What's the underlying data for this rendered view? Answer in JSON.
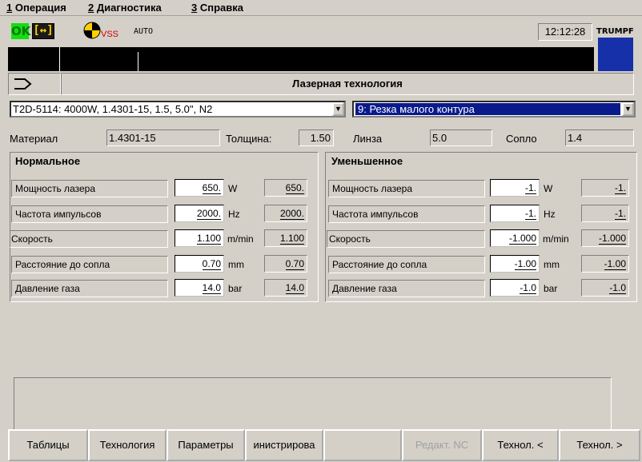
{
  "menu": [
    {
      "num": "1",
      "label": "Операция"
    },
    {
      "num": "2",
      "label": "Диагностика"
    },
    {
      "num": "3",
      "label": "Справка"
    }
  ],
  "status": {
    "ok_label": "OK",
    "plug_icon": "connector-icon",
    "vss": "VSS",
    "mode": "AUTO",
    "time": "12:12:28",
    "brand": "TRUMPF",
    "colors": {
      "ok_bg": "#10e010",
      "vss": "#d00000",
      "brand_box": "#1530a8"
    }
  },
  "header": {
    "nav_icon": "arrow-right-icon",
    "title": "Лазерная технология"
  },
  "selectors": {
    "program": "T2D-5114:  4000W,  1.4301-15,  1.5,  5.0\", N2",
    "technology": "9:  Резка малого контура",
    "selected_color": "#0a1a8c"
  },
  "info": {
    "material_label": "Материал",
    "material_value": "1.4301-15",
    "thickness_label": "Толщина:",
    "thickness_value": "1.50",
    "lens_label": "Линза",
    "lens_value": "5.0",
    "nozzle_label": "Сопло",
    "nozzle_value": "1.4"
  },
  "normal": {
    "title": "Нормальное",
    "rows": [
      {
        "label": "Мощность лазера",
        "value": "650.",
        "unit": "W",
        "readonly": "650."
      },
      {
        "label": "Частота импульсов",
        "value": "2000.",
        "unit": "Hz",
        "readonly": "2000."
      },
      {
        "label": "Скорость",
        "value": "1.100",
        "unit": "m/min",
        "readonly": "1.100"
      },
      {
        "label": "Расстояние до сопла",
        "value": "0.70",
        "unit": "mm",
        "readonly": "0.70"
      },
      {
        "label": "Давление газа",
        "value": "14.0",
        "unit": "bar",
        "readonly": "14.0"
      }
    ]
  },
  "reduced": {
    "title": "Уменьшенное",
    "rows": [
      {
        "label": "Мощность лазера",
        "value": "-1.",
        "unit": "W",
        "readonly": "-1."
      },
      {
        "label": "Частота импульсов",
        "value": "-1.",
        "unit": "Hz",
        "readonly": "-1."
      },
      {
        "label": "Скорость",
        "value": "-1.000",
        "unit": "m/min",
        "readonly": "-1.000"
      },
      {
        "label": "Расстояние до сопла",
        "value": "-1.00",
        "unit": "mm",
        "readonly": "-1.00"
      },
      {
        "label": "Давление газа",
        "value": "-1.0",
        "unit": "bar",
        "readonly": "-1.0"
      }
    ]
  },
  "softkeys": [
    {
      "label": "Таблицы",
      "enabled": true
    },
    {
      "label": "Технология",
      "enabled": true
    },
    {
      "label": "Параметры",
      "enabled": true
    },
    {
      "label": "инистрирова",
      "enabled": true
    },
    {
      "label": "",
      "enabled": true
    },
    {
      "label": "Редакт. NC",
      "enabled": false
    },
    {
      "label": "Технол. <",
      "enabled": true
    },
    {
      "label": "Технол. >",
      "enabled": true
    }
  ]
}
